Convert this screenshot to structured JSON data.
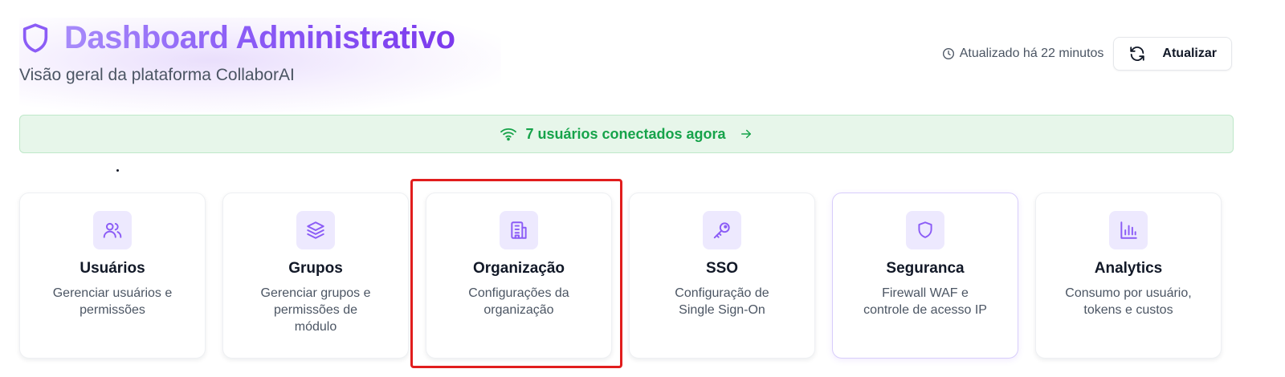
{
  "header": {
    "title": "Dashboard Administrativo",
    "subtitle": "Visão geral da plataforma CollaborAI",
    "icon": "shield-icon"
  },
  "status": {
    "updated_text": "Atualizado há 22 minutos",
    "refresh_label": "Atualizar"
  },
  "banner": {
    "text": "7 usuários conectados agora",
    "color": "#16a34a"
  },
  "cards": [
    {
      "icon": "users-icon",
      "title": "Usuários",
      "desc_line1": "Gerenciar usuários e",
      "desc_line2": "permissões",
      "desc_line3": ""
    },
    {
      "icon": "layers-icon",
      "title": "Grupos",
      "desc_line1": "Gerenciar grupos e",
      "desc_line2": "permissões de",
      "desc_line3": "módulo"
    },
    {
      "icon": "building-icon",
      "title": "Organização",
      "desc_line1": "Configurações da",
      "desc_line2": "organização",
      "desc_line3": ""
    },
    {
      "icon": "key-icon",
      "title": "SSO",
      "desc_line1": "Configuração de",
      "desc_line2": "Single Sign-On",
      "desc_line3": ""
    },
    {
      "icon": "shield-icon",
      "title": "Seguranca",
      "desc_line1": "Firewall WAF e",
      "desc_line2": "controle de acesso IP",
      "desc_line3": ""
    },
    {
      "icon": "bar-chart-icon",
      "title": "Analytics",
      "desc_line1": "Consumo por usuário,",
      "desc_line2": "tokens e custos",
      "desc_line3": ""
    }
  ],
  "colors": {
    "accent": "#8b5cf6",
    "icon_bg": "#ede9fe",
    "highlight": "#e11d1d"
  }
}
